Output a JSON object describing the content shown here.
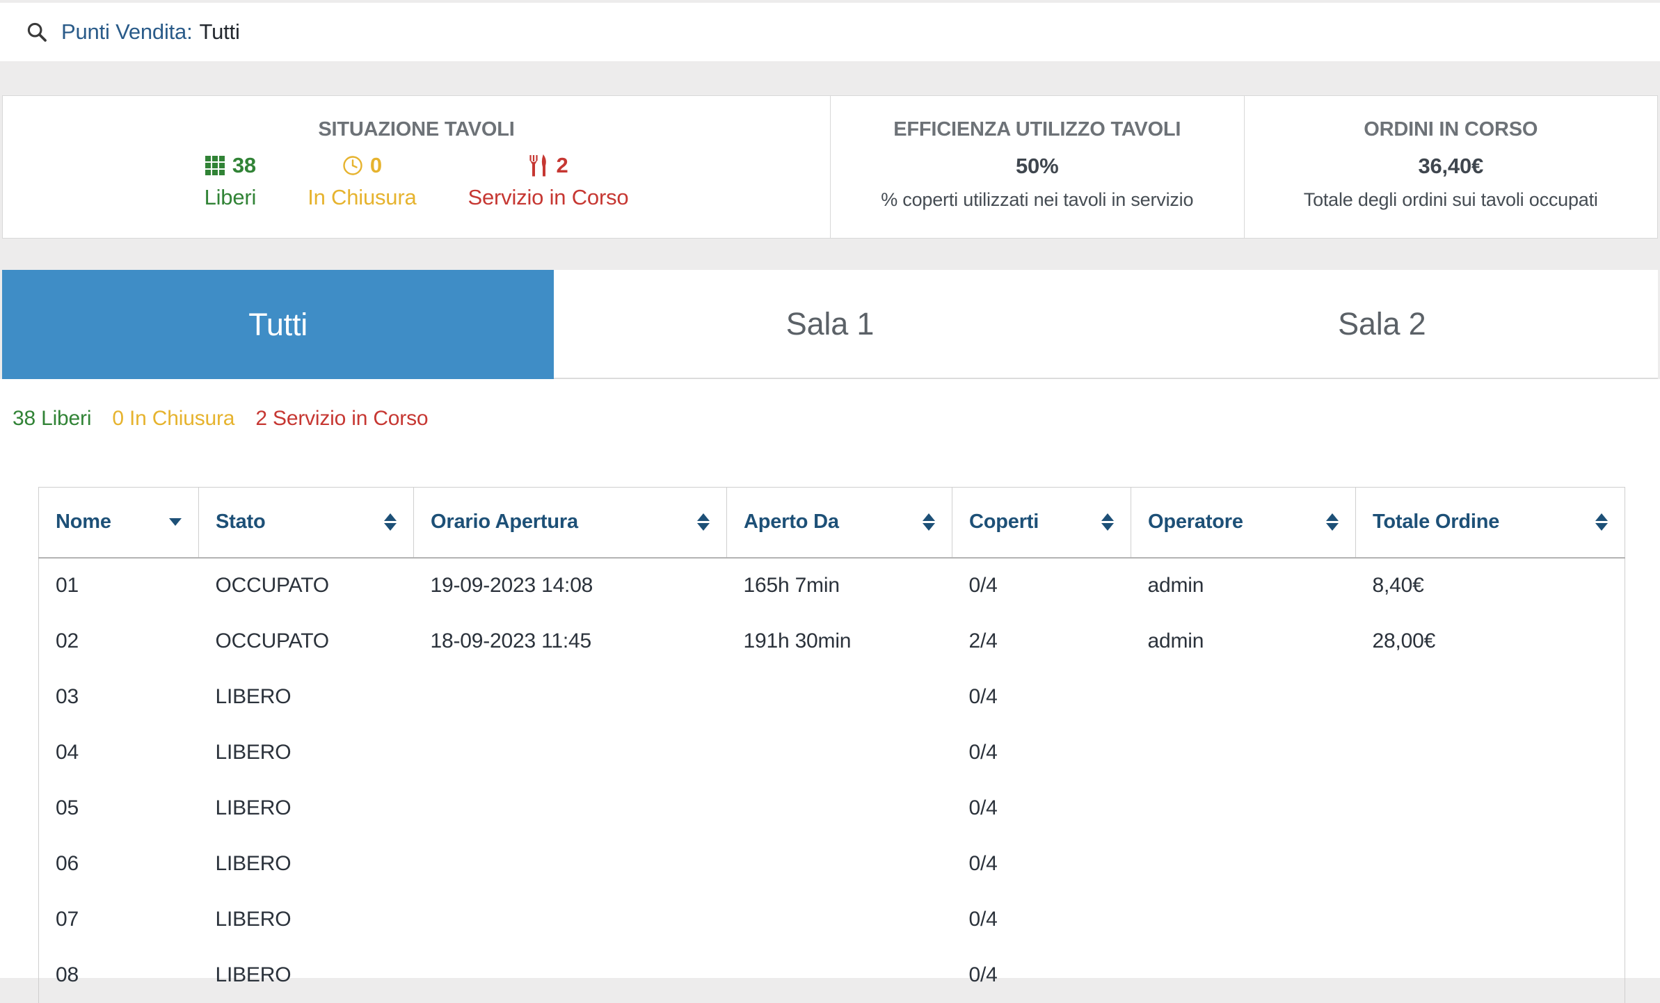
{
  "search_bar": {
    "label": "Punti Vendita:",
    "value": "Tutti"
  },
  "summary": {
    "situazione": {
      "title": "SITUAZIONE TAVOLI",
      "stats": [
        {
          "icon": "table-grid-icon",
          "value": "38",
          "label": "Liberi"
        },
        {
          "icon": "clock-icon",
          "value": "0",
          "label": "In Chiusura"
        },
        {
          "icon": "utensils-icon",
          "value": "2",
          "label": "Servizio in Corso"
        }
      ]
    },
    "efficienza": {
      "title": "EFFICIENZA UTILIZZO TAVOLI",
      "value": "50%",
      "subtitle": "% coperti utilizzati nei tavoli in servizio"
    },
    "ordini": {
      "title": "ORDINI IN CORSO",
      "value": "36,40€",
      "subtitle": "Totale degli ordini sui tavoli occupati"
    }
  },
  "tabs": [
    {
      "label": "Tutti",
      "active": true
    },
    {
      "label": "Sala 1",
      "active": false
    },
    {
      "label": "Sala 2",
      "active": false
    }
  ],
  "status_line": {
    "liberi": "38 Liberi",
    "in_chiusura": "0 In Chiusura",
    "servizio": "2 Servizio in Corso"
  },
  "table": {
    "columns": [
      {
        "label": "Nome",
        "sort": "desc"
      },
      {
        "label": "Stato",
        "sort": "none"
      },
      {
        "label": "Orario Apertura",
        "sort": "none"
      },
      {
        "label": "Aperto Da",
        "sort": "none"
      },
      {
        "label": "Coperti",
        "sort": "none"
      },
      {
        "label": "Operatore",
        "sort": "none"
      },
      {
        "label": "Totale Ordine",
        "sort": "none"
      }
    ],
    "rows": [
      {
        "nome": "01",
        "stato": "OCCUPATO",
        "orario_apertura": "19-09-2023 14:08",
        "aperto_da": "165h 7min",
        "coperti": "0/4",
        "operatore": "admin",
        "totale_ordine": "8,40€"
      },
      {
        "nome": "02",
        "stato": "OCCUPATO",
        "orario_apertura": "18-09-2023 11:45",
        "aperto_da": "191h 30min",
        "coperti": "2/4",
        "operatore": "admin",
        "totale_ordine": "28,00€"
      },
      {
        "nome": "03",
        "stato": "LIBERO",
        "orario_apertura": "",
        "aperto_da": "",
        "coperti": "0/4",
        "operatore": "",
        "totale_ordine": ""
      },
      {
        "nome": "04",
        "stato": "LIBERO",
        "orario_apertura": "",
        "aperto_da": "",
        "coperti": "0/4",
        "operatore": "",
        "totale_ordine": ""
      },
      {
        "nome": "05",
        "stato": "LIBERO",
        "orario_apertura": "",
        "aperto_da": "",
        "coperti": "0/4",
        "operatore": "",
        "totale_ordine": ""
      },
      {
        "nome": "06",
        "stato": "LIBERO",
        "orario_apertura": "",
        "aperto_da": "",
        "coperti": "0/4",
        "operatore": "",
        "totale_ordine": ""
      },
      {
        "nome": "07",
        "stato": "LIBERO",
        "orario_apertura": "",
        "aperto_da": "",
        "coperti": "0/4",
        "operatore": "",
        "totale_ordine": ""
      },
      {
        "nome": "08",
        "stato": "LIBERO",
        "orario_apertura": "",
        "aperto_da": "",
        "coperti": "0/4",
        "operatore": "",
        "totale_ordine": ""
      }
    ]
  },
  "colors": {
    "accent_blue": "#3f8dc6",
    "link_blue": "#2a5b89",
    "green": "#318336",
    "amber": "#e6b32e",
    "red": "#c63732",
    "occupato_maroon": "#7b2c24",
    "header_navy": "#1d5077"
  }
}
